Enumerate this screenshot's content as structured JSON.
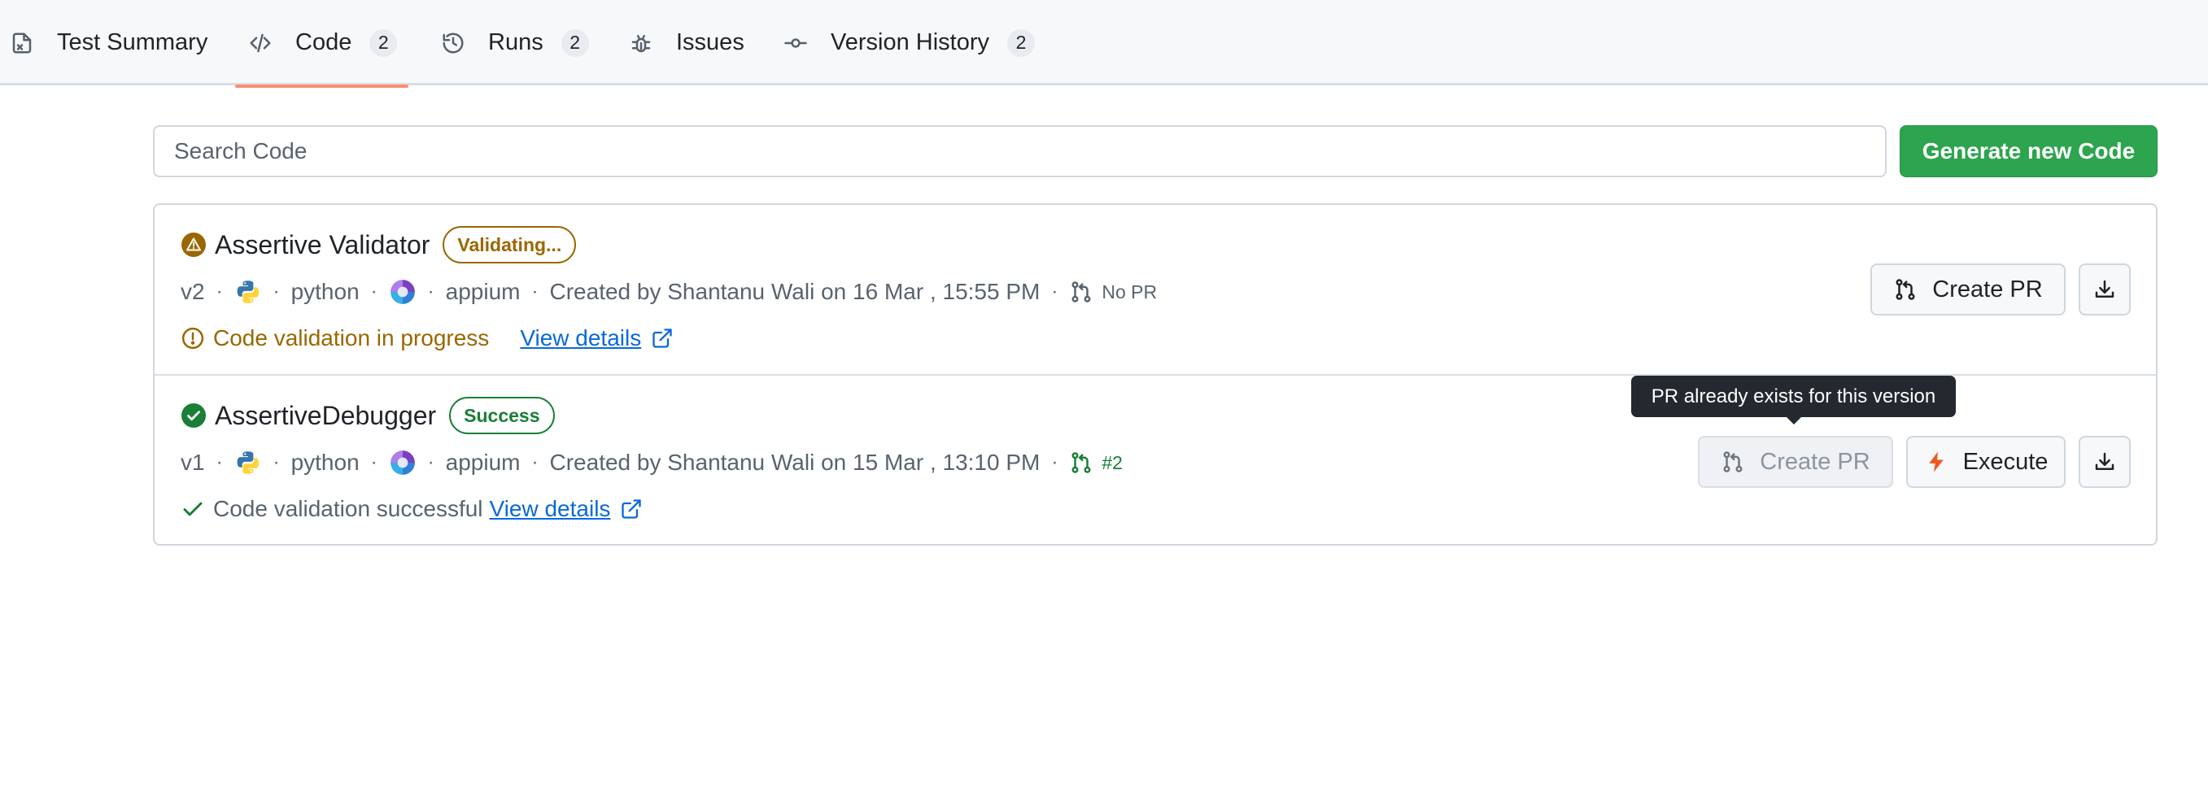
{
  "tabs": [
    {
      "label": "Test Summary",
      "icon": "file-x-icon",
      "count": null,
      "active": false
    },
    {
      "label": "Code",
      "icon": "code-icon",
      "count": "2",
      "active": true
    },
    {
      "label": "Runs",
      "icon": "history-icon",
      "count": "2",
      "active": false
    },
    {
      "label": "Issues",
      "icon": "bug-icon",
      "count": null,
      "active": false
    },
    {
      "label": "Version History",
      "icon": "commit-icon",
      "count": "2",
      "active": false
    }
  ],
  "search": {
    "placeholder": "Search Code",
    "value": ""
  },
  "generate_button": {
    "label": "Generate new Code"
  },
  "items": [
    {
      "name": "Assertive Validator",
      "status_icon": "warning-icon",
      "badge": "Validating...",
      "version": "v2",
      "language": "python",
      "language_icon": "python-icon",
      "framework": "appium",
      "framework_icon": "appium-icon",
      "created": "Created by Shantanu Wali on 16 Mar , 15:55 PM",
      "pr_icon": "pull-request-icon",
      "pr": "No PR",
      "validation_icon": "alert-circle-icon",
      "validation": "Code validation in progress",
      "details_link": "View details",
      "actions": {
        "create_pr": "Create PR"
      }
    },
    {
      "name": "AssertiveDebugger",
      "status_icon": "check-circle-icon",
      "badge": "Success",
      "version": "v1",
      "language": "python",
      "language_icon": "python-icon",
      "framework": "appium",
      "framework_icon": "appium-icon",
      "created": "Created by Shantanu Wali on 15 Mar , 13:10 PM",
      "pr_icon": "pull-request-icon",
      "pr": "#2",
      "validation_icon": "check-icon",
      "validation": "Code validation successful",
      "details_link": "View details",
      "actions": {
        "create_pr": "Create PR",
        "execute": "Execute"
      }
    }
  ],
  "tooltip": "PR already exists for this version",
  "colors": {
    "accent": "#fd8c73",
    "success": "#1a7f37",
    "warning": "#9a6700",
    "link": "#0969da",
    "primary_button": "#2da44e"
  }
}
